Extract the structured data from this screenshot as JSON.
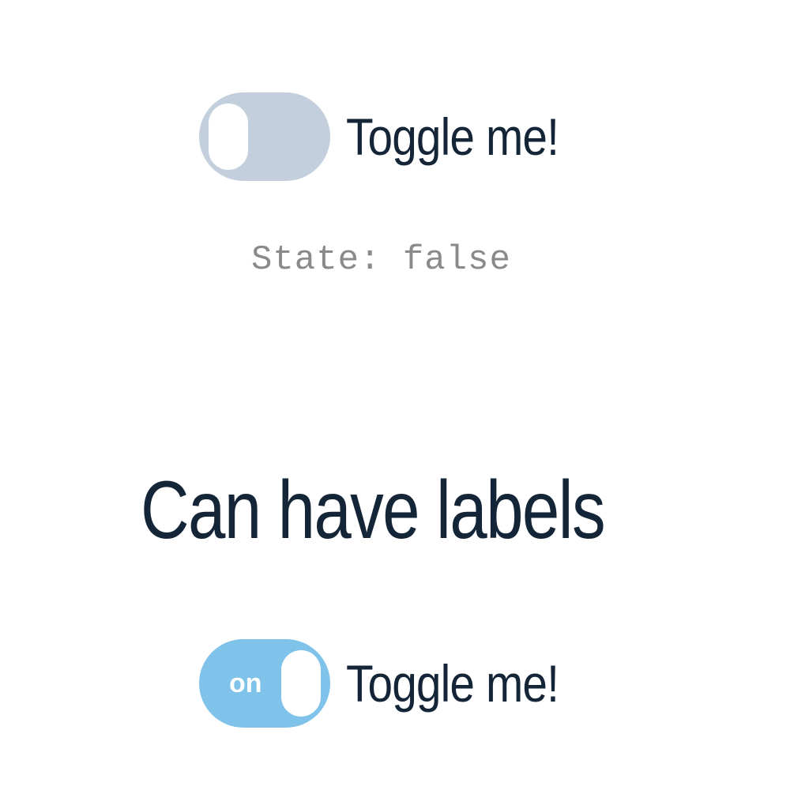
{
  "toggles": [
    {
      "label": "Toggle me!",
      "checked": false,
      "inner_label": ""
    },
    {
      "label": "Toggle me!",
      "checked": true,
      "inner_label": "on"
    }
  ],
  "state": {
    "text": "State: false"
  },
  "section": {
    "heading": "Can have labels"
  },
  "colors": {
    "switch_off": "#c3cfdc",
    "switch_on": "#7fc2ea",
    "text": "#152538",
    "state_text": "#8a8a8a"
  }
}
